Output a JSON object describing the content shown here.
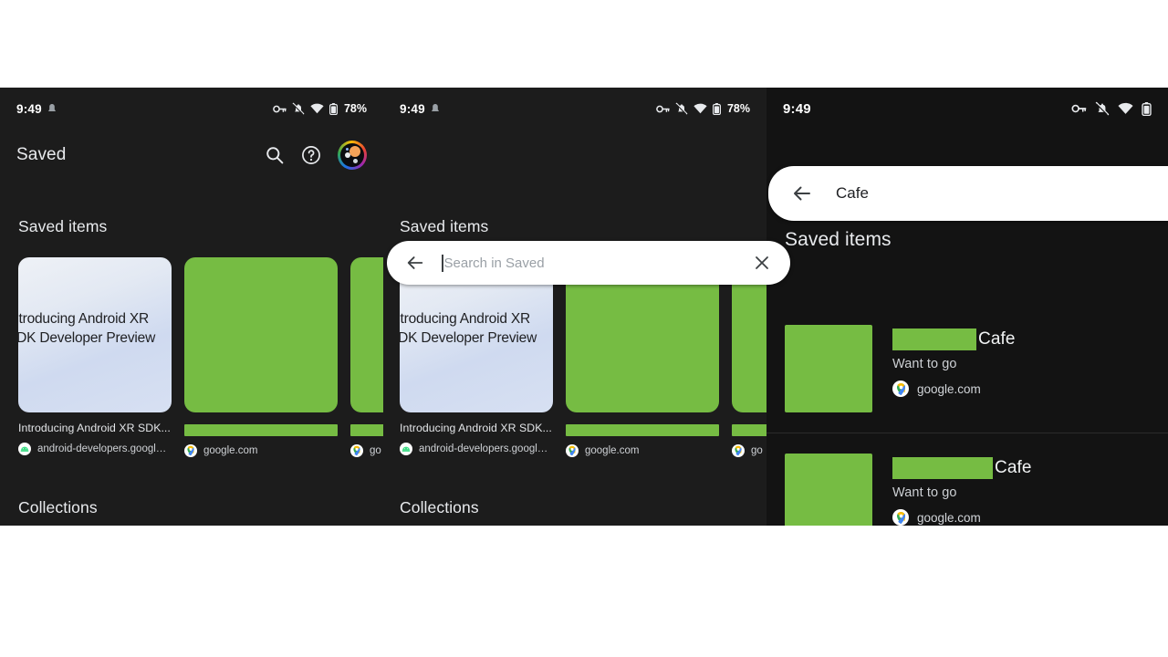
{
  "theme": {
    "background": "#1c1c1c",
    "stage_background": "#111111",
    "redaction_green": "#76bc43",
    "text_primary": "#e8eaed",
    "text_secondary": "#cdd0d4",
    "search_bar_background": "#ffffff"
  },
  "status_bar": {
    "time": "9:49",
    "battery_percent": "78%",
    "icons": [
      "vpn-key-icon",
      "notifications-off-icon",
      "wifi-icon",
      "battery-icon"
    ]
  },
  "panel_saved": {
    "app_bar": {
      "title": "Saved",
      "actions": [
        "search-icon",
        "help-icon",
        "account-avatar"
      ]
    },
    "saved_items_header": "Saved items",
    "collections_header": "Collections",
    "cards": [
      {
        "thumb_kind": "blog",
        "thumb_text_line1": "Introducing Android XR",
        "thumb_text_line2": "SDK Developer Preview",
        "title": "Introducing Android XR SDK...",
        "title_redacted": false,
        "source": "android-developers.googleblo...",
        "favicon": "android-icon"
      },
      {
        "thumb_kind": "redacted",
        "title": "",
        "title_redacted": true,
        "source": "google.com",
        "favicon": "google-maps-pin-icon"
      },
      {
        "thumb_kind": "redacted",
        "title": "",
        "title_redacted": true,
        "source": "go",
        "favicon": "google-maps-pin-icon"
      }
    ]
  },
  "panel_search_empty": {
    "search": {
      "value": "",
      "placeholder": "Search in Saved",
      "back_icon": "back-arrow-icon",
      "clear_icon": "close-icon",
      "has_caret": true
    },
    "saved_items_header": "Saved items",
    "collections_header": "Collections",
    "cards": [
      {
        "thumb_kind": "blog",
        "thumb_text_line1": "Introducing Android XR",
        "thumb_text_line2": "SDK Developer Preview",
        "title": "Introducing Android XR SDK...",
        "title_redacted": false,
        "source": "android-developers.googleblo...",
        "favicon": "android-icon"
      },
      {
        "thumb_kind": "redacted",
        "title": "",
        "title_redacted": true,
        "source": "google.com",
        "favicon": "google-maps-pin-icon"
      },
      {
        "thumb_kind": "redacted",
        "title": "",
        "title_redacted": true,
        "source": "go",
        "favicon": "google-maps-pin-icon"
      }
    ]
  },
  "panel_search_results": {
    "search": {
      "value": "Cafe",
      "placeholder": "Search in Saved",
      "back_icon": "back-arrow-icon"
    },
    "saved_items_header": "Saved items",
    "results": [
      {
        "title": "Cafe",
        "title_redacted_prefix": true,
        "subtitle": "Want to go",
        "source": "google.com",
        "favicon": "google-maps-pin-icon"
      },
      {
        "title": "Cafe",
        "title_redacted_prefix": true,
        "subtitle": "Want to go",
        "source": "google.com",
        "favicon": "google-maps-pin-icon"
      }
    ]
  }
}
